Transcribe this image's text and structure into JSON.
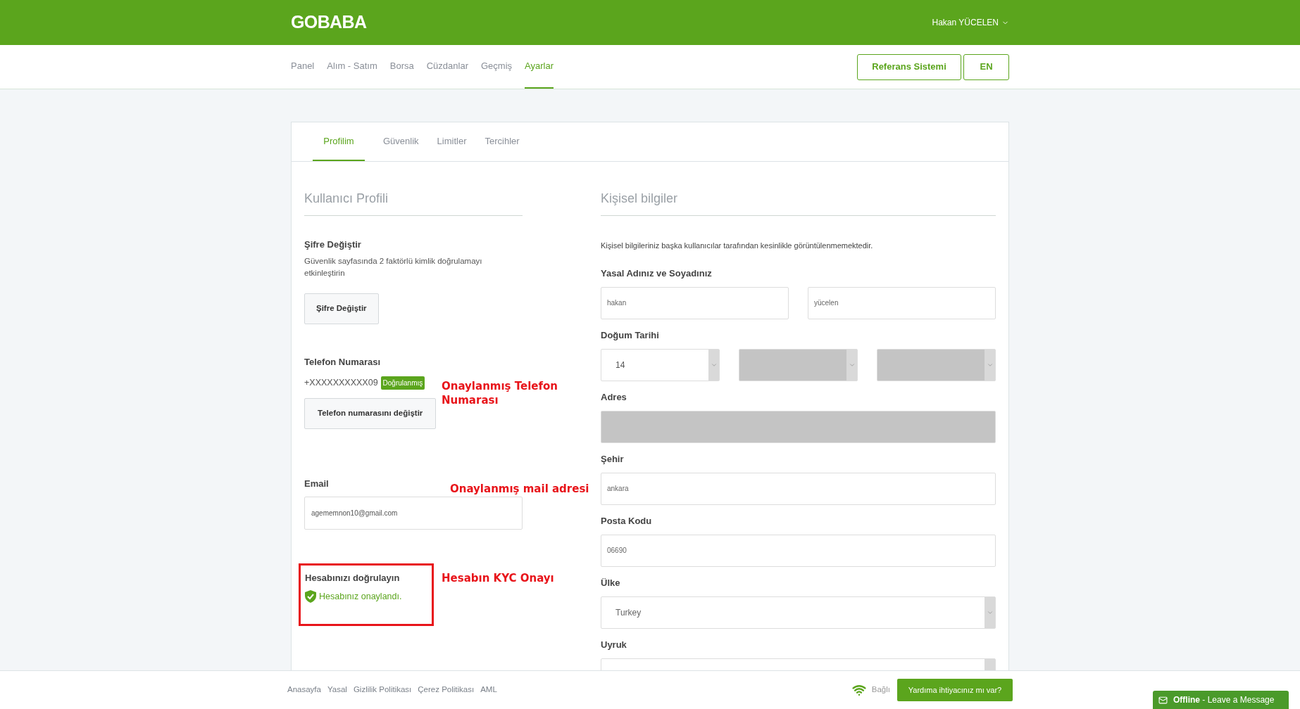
{
  "header": {
    "logo": "GOBABA",
    "user": "Hakan YÜCELEN"
  },
  "nav": {
    "items": [
      {
        "label": "Panel",
        "selected": false
      },
      {
        "label": "Alım - Satım",
        "selected": false
      },
      {
        "label": "Borsa",
        "selected": false
      },
      {
        "label": "Cüzdanlar",
        "selected": false
      },
      {
        "label": "Geçmiş",
        "selected": false
      },
      {
        "label": "Ayarlar",
        "selected": true
      }
    ],
    "buttons": [
      "Referans Sistemi",
      "EN"
    ]
  },
  "tabs": [
    {
      "label": "Profilim",
      "selected": true
    },
    {
      "label": "Güvenlik",
      "selected": false
    },
    {
      "label": "Limitler",
      "selected": false
    },
    {
      "label": "Tercihler",
      "selected": false
    }
  ],
  "profile": {
    "title": "Kullanıcı Profili",
    "password": {
      "label": "Şifre Değiştir",
      "description": "Güvenlik sayfasında 2 faktörlü kimlik doğrulamayı etkinleştirin",
      "button": "Şifre Değiştir"
    },
    "phone": {
      "label": "Telefon Numarası",
      "number": "+XXXXXXXXXX09",
      "badge": "Doğrulanmış",
      "button": "Telefon numarasını değiştir"
    },
    "email": {
      "label": "Email",
      "value": "agememnon10@gmail.com"
    },
    "kyc": {
      "label": "Hesabınızı doğrulayın",
      "status": "Hesabınız onaylandı.",
      "verified": true
    }
  },
  "annotations": [
    {
      "text": "Onaylanmış Telefon Numarası"
    },
    {
      "text": "Onaylanmış mail adresi"
    },
    {
      "text": "Hesabın KYC Onayı"
    }
  ],
  "personal": {
    "title": "Kişisel bilgiler",
    "note": "Kişisel bilgileriniz başka kullanıcılar tarafından kesinlikle görüntülenmemektedir.",
    "fields": [
      {
        "label": "Yasal Adınız ve Soyadınız",
        "kind": "pair",
        "values": [
          "hakan",
          "yücelen"
        ]
      },
      {
        "label": "Doğum Tarihi",
        "kind": "date",
        "parts": [
          {
            "value": "14",
            "redacted": false
          },
          {
            "redacted": true
          },
          {
            "redacted": true
          }
        ]
      },
      {
        "label": "Adres",
        "kind": "text",
        "redacted": true
      },
      {
        "label": "Şehir",
        "kind": "text",
        "value": "ankara",
        "redacted": false
      },
      {
        "label": "Posta Kodu",
        "kind": "text",
        "value": "06690",
        "redacted": false
      },
      {
        "label": "Ülke",
        "kind": "select",
        "value": "Turkey"
      },
      {
        "label": "Uyruk",
        "kind": "select"
      }
    ]
  },
  "footer": {
    "links": [
      "Anasayfa",
      "Yasal",
      "Gizlilik Politikası",
      "Çerez Politikası",
      "AML"
    ],
    "connection": "Bağlı",
    "help_button": "Yardıma ihtiyacınız mı var?"
  },
  "chat": {
    "status": "Offline",
    "message": "- Leave a Message"
  }
}
